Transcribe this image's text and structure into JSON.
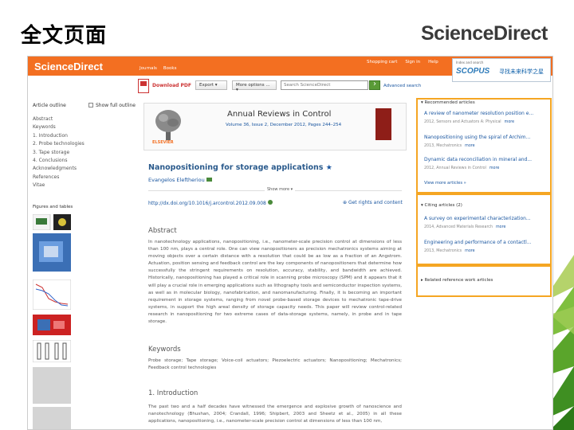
{
  "slide": {
    "title": "全文页面",
    "brand": "ScienceDirect"
  },
  "header": {
    "logo": "ScienceDirect",
    "nav": [
      "Journals",
      "Books"
    ],
    "right_links": [
      "Shopping cart",
      "Sign in",
      "Help"
    ],
    "scopus_small": "Index and search",
    "scopus_word": "SCOPUS",
    "scopus_cn": "寻找未来科学之星"
  },
  "toolbar": {
    "download_pdf": "Download PDF",
    "export": "Export",
    "more_options": "More options ...",
    "search_placeholder": "Search ScienceDirect",
    "advanced_search": "Advanced search"
  },
  "outline": {
    "heading": "Article outline",
    "show_full": "Show full outline",
    "items": [
      "Abstract",
      "Keywords",
      "1. Introduction",
      "2. Probe technologies",
      "3. Tape storage",
      "4. Conclusions",
      "Acknowledgments",
      "References",
      "Vitae"
    ],
    "figures_heading": "Figures and tables"
  },
  "article": {
    "elsevier": "ELSEVIER",
    "journal": "Annual Reviews in Control",
    "volume": "Volume 36, Issue 2, December 2012, Pages 244–254",
    "title": "Nanopositioning for storage applications",
    "author": "Evangelos Eleftheriou",
    "show_more": "Show more",
    "doi": "http://dx.doi.org/10.1016/j.arcontrol.2012.09.008",
    "rights": "Get rights and content",
    "abstract_heading": "Abstract",
    "abstract": "In nanotechnology applications, nanopositioning, i.e., nanometer-scale precision control at dimensions of less than 100 nm, plays a central role. One can view nanopositioners as precision mechatronics systems aiming at moving objects over a certain distance with a resolution that could be as low as a fraction of an Angstrom. Actuation, position sensing and feedback control are the key components of nanopositioners that determine how successfully the stringent requirements on resolution, accuracy, stability, and bandwidth are achieved. Historically, nanopositioning has played a critical role in scanning probe microscopy (SPM) and it appears that it will play a crucial role in emerging applications such as lithography tools and semiconductor inspection systems, as well as in molecular biology, nanofabrication, and nanomanufacturing. Finally, it is becoming an important requirement in storage systems, ranging from novel probe-based storage devices to mechatronic tape-drive systems, in support the high areal density of storage capacity needs. This paper will review control-related research in nanopositioning for two extreme cases of data-storage systems, namely, in probe and in tape storage.",
    "keywords_heading": "Keywords",
    "keywords": "Probe storage; Tape storage; Voice-coil actuators; Piezoelectric actuators; Nanopositioning; Mechatronics; Feedback control technologies",
    "intro_heading": "1. Introduction",
    "intro": "The past two and a half decades have witnessed the emergence and explosive growth of nanoscience and nanotechnology (Bhushan, 2004; Crandall, 1996; Shipbert, 2003 and Sheetz et al., 2005) in all these applications, nanopositioning, i.e., nanometer-scale precision control at dimensions of less than 100 nm,"
  },
  "sidebar": {
    "recommended_heading": "Recommended articles",
    "recommended": [
      {
        "title": "A review of nanometer resolution position e...",
        "meta": "2012, Sensors and Actuators A: Physical",
        "more": "more"
      },
      {
        "title": "Nanopositioning using the spiral of Archim...",
        "meta": "2013, Mechatronics",
        "more": "more"
      },
      {
        "title": "Dynamic data reconciliation in mineral and...",
        "meta": "2012, Annual Reviews in Control",
        "more": "more"
      }
    ],
    "view_more": "View more articles »",
    "citing_heading": "Citing articles (2)",
    "citing": [
      {
        "title": "A survey on experimental characterization...",
        "meta": "2014, Advanced Materials Research",
        "more": "more"
      },
      {
        "title": "Engineering and performance of a contactl...",
        "meta": "2013, Mechatronics",
        "more": "more"
      }
    ],
    "related_heading": "Related reference work articles"
  }
}
